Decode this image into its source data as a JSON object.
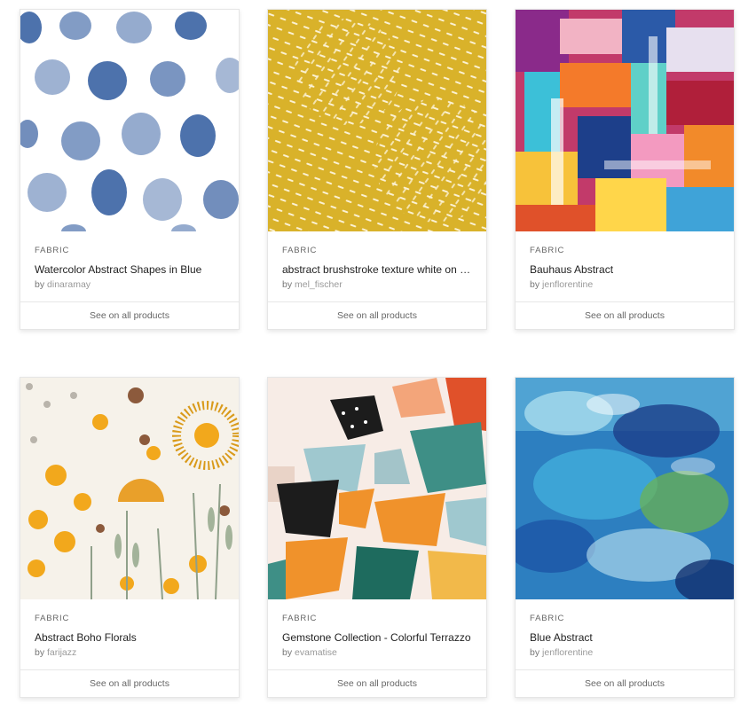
{
  "products": [
    {
      "category": "FABRIC",
      "title": "Watercolor Abstract Shapes in Blue",
      "by": "by",
      "designer": "dinaramay",
      "cta": "See on all products",
      "pattern": "watercolor-blue-dots"
    },
    {
      "category": "FABRIC",
      "title": "abstract brushstroke texture white on mustard",
      "by": "by",
      "designer": "mel_fischer",
      "cta": "See on all products",
      "pattern": "mustard-brushstroke"
    },
    {
      "category": "FABRIC",
      "title": "Bauhaus Abstract",
      "by": "by",
      "designer": "jenflorentine",
      "cta": "See on all products",
      "pattern": "bauhaus-multicolor"
    },
    {
      "category": "FABRIC",
      "title": "Abstract Boho Florals",
      "by": "by",
      "designer": "farijazz",
      "cta": "See on all products",
      "pattern": "boho-florals"
    },
    {
      "category": "FABRIC",
      "title": "Gemstone Collection - Colorful Terrazzo",
      "by": "by",
      "designer": "evamatise",
      "cta": "See on all products",
      "pattern": "terrazzo"
    },
    {
      "category": "FABRIC",
      "title": "Blue Abstract",
      "by": "by",
      "designer": "jenflorentine",
      "cta": "See on all products",
      "pattern": "blue-abstract-paint"
    }
  ],
  "colors": {
    "watercolor_blue": "#2f5a9e",
    "mustard": "#d9b22a",
    "terrazzo_orange": "#f0922b",
    "terrazzo_teal": "#3e8f86",
    "abstract_blue": "#2d7fc0"
  }
}
